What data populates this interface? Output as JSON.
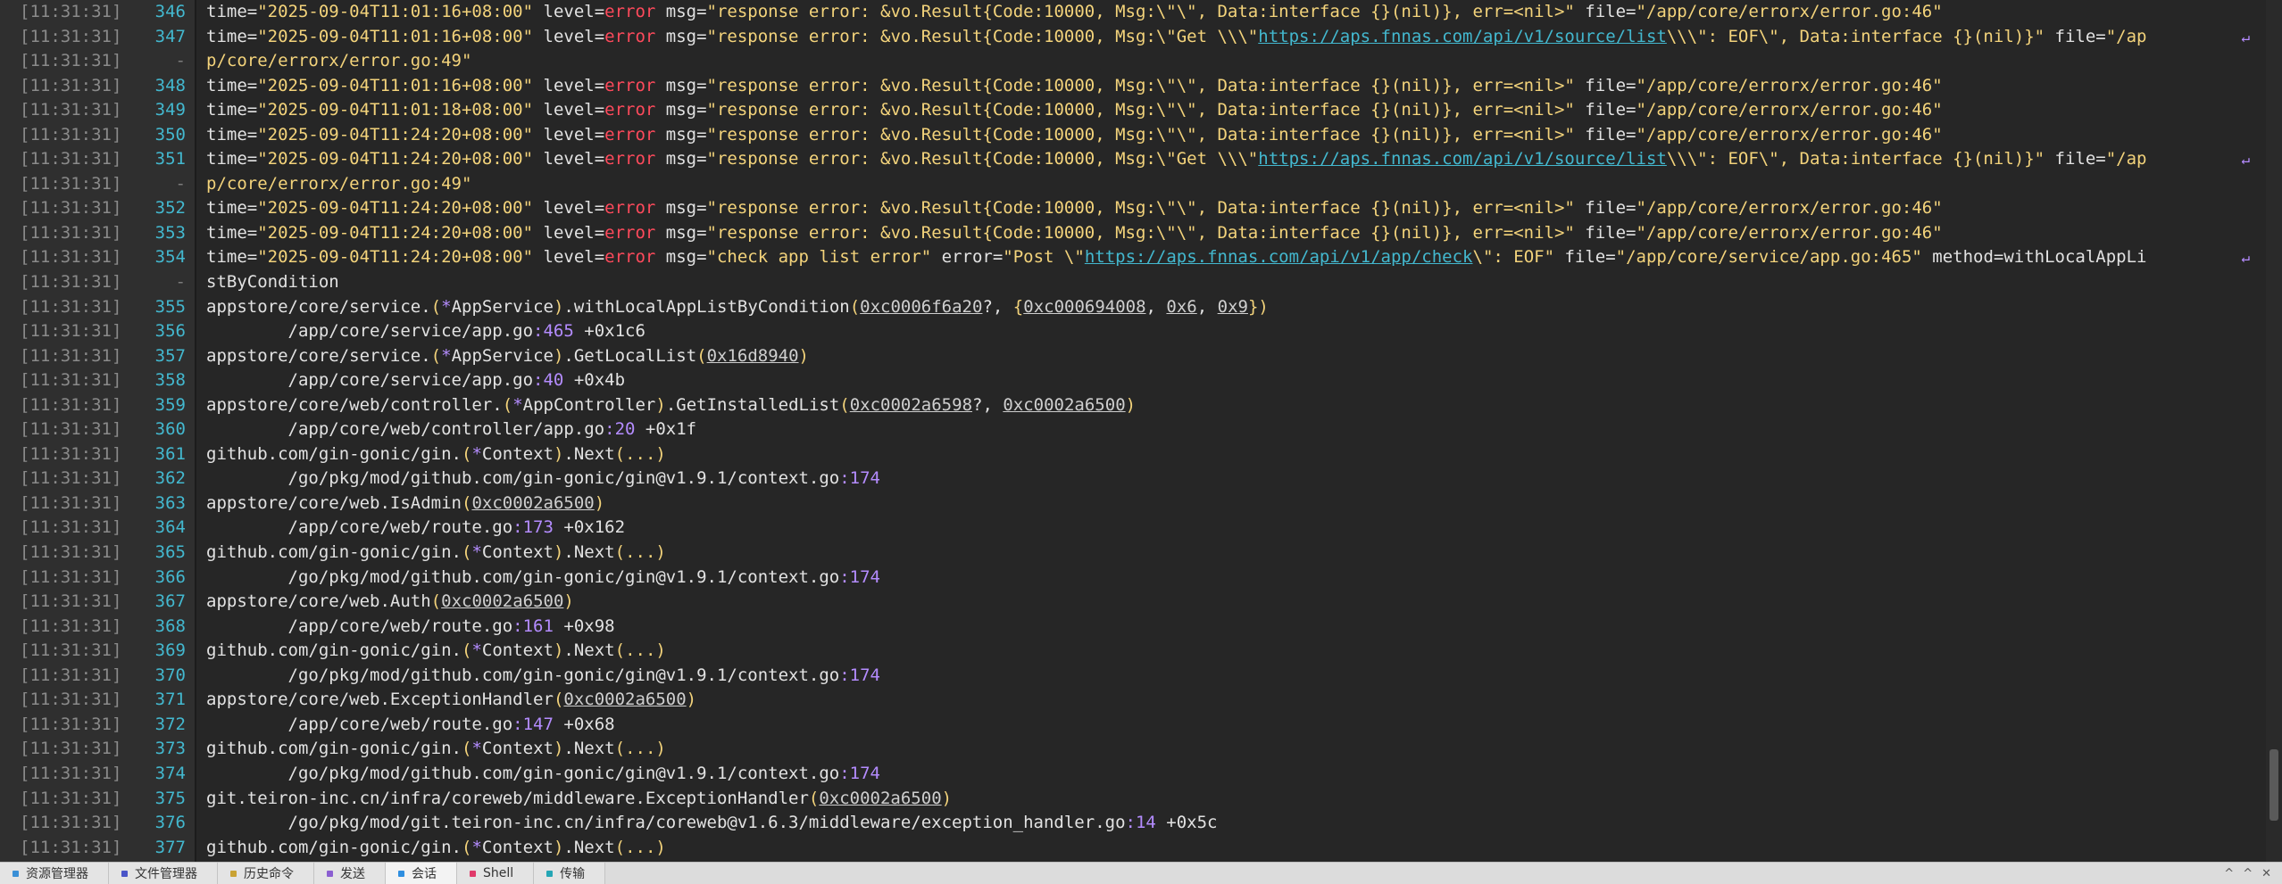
{
  "terminal": {
    "lines": [
      {
        "ts": "[11:31:31]",
        "ln": "346",
        "wrap": false,
        "segs": [
          [
            "t",
            "time="
          ],
          [
            "s",
            "\"2025-09-04T11:01:16+08:00\""
          ],
          [
            "t",
            " level="
          ],
          [
            "e",
            "error"
          ],
          [
            "t",
            " msg="
          ],
          [
            "s",
            "\"response error: &vo.Result{Code:10000, Msg:\\\"\\\", Data:interface {}(nil)}, err=<nil>\""
          ],
          [
            "t",
            " file="
          ],
          [
            "s",
            "\"/app/core/errorx/error.go:46\""
          ]
        ]
      },
      {
        "ts": "[11:31:31]",
        "ln": "347",
        "wrap": true,
        "segs": [
          [
            "t",
            "time="
          ],
          [
            "s",
            "\"2025-09-04T11:01:16+08:00\""
          ],
          [
            "t",
            " level="
          ],
          [
            "e",
            "error"
          ],
          [
            "t",
            " msg="
          ],
          [
            "s",
            "\"response error: &vo.Result{Code:10000, Msg:\\\"Get \\\\\\\""
          ],
          [
            "u",
            "https://aps.fnnas.com/api/v1/source/list"
          ],
          [
            "s",
            "\\\\\\\": EOF\\\", Data:interface {}(nil)}\""
          ],
          [
            "t",
            " file="
          ],
          [
            "s",
            "\"/ap"
          ]
        ]
      },
      {
        "ts": "[11:31:31]",
        "ln": "-",
        "wrap": false,
        "segs": [
          [
            "s",
            "p/core/errorx/error.go:49\""
          ]
        ]
      },
      {
        "ts": "[11:31:31]",
        "ln": "348",
        "wrap": false,
        "segs": [
          [
            "t",
            "time="
          ],
          [
            "s",
            "\"2025-09-04T11:01:16+08:00\""
          ],
          [
            "t",
            " level="
          ],
          [
            "e",
            "error"
          ],
          [
            "t",
            " msg="
          ],
          [
            "s",
            "\"response error: &vo.Result{Code:10000, Msg:\\\"\\\", Data:interface {}(nil)}, err=<nil>\""
          ],
          [
            "t",
            " file="
          ],
          [
            "s",
            "\"/app/core/errorx/error.go:46\""
          ]
        ]
      },
      {
        "ts": "[11:31:31]",
        "ln": "349",
        "wrap": false,
        "segs": [
          [
            "t",
            "time="
          ],
          [
            "s",
            "\"2025-09-04T11:01:18+08:00\""
          ],
          [
            "t",
            " level="
          ],
          [
            "e",
            "error"
          ],
          [
            "t",
            " msg="
          ],
          [
            "s",
            "\"response error: &vo.Result{Code:10000, Msg:\\\"\\\", Data:interface {}(nil)}, err=<nil>\""
          ],
          [
            "t",
            " file="
          ],
          [
            "s",
            "\"/app/core/errorx/error.go:46\""
          ]
        ]
      },
      {
        "ts": "[11:31:31]",
        "ln": "350",
        "wrap": false,
        "segs": [
          [
            "t",
            "time="
          ],
          [
            "s",
            "\"2025-09-04T11:24:20+08:00\""
          ],
          [
            "t",
            " level="
          ],
          [
            "e",
            "error"
          ],
          [
            "t",
            " msg="
          ],
          [
            "s",
            "\"response error: &vo.Result{Code:10000, Msg:\\\"\\\", Data:interface {}(nil)}, err=<nil>\""
          ],
          [
            "t",
            " file="
          ],
          [
            "s",
            "\"/app/core/errorx/error.go:46\""
          ]
        ]
      },
      {
        "ts": "[11:31:31]",
        "ln": "351",
        "wrap": true,
        "segs": [
          [
            "t",
            "time="
          ],
          [
            "s",
            "\"2025-09-04T11:24:20+08:00\""
          ],
          [
            "t",
            " level="
          ],
          [
            "e",
            "error"
          ],
          [
            "t",
            " msg="
          ],
          [
            "s",
            "\"response error: &vo.Result{Code:10000, Msg:\\\"Get \\\\\\\""
          ],
          [
            "u",
            "https://aps.fnnas.com/api/v1/source/list"
          ],
          [
            "s",
            "\\\\\\\": EOF\\\", Data:interface {}(nil)}\""
          ],
          [
            "t",
            " file="
          ],
          [
            "s",
            "\"/ap"
          ]
        ]
      },
      {
        "ts": "[11:31:31]",
        "ln": "-",
        "wrap": false,
        "segs": [
          [
            "s",
            "p/core/errorx/error.go:49\""
          ]
        ]
      },
      {
        "ts": "[11:31:31]",
        "ln": "352",
        "wrap": false,
        "segs": [
          [
            "t",
            "time="
          ],
          [
            "s",
            "\"2025-09-04T11:24:20+08:00\""
          ],
          [
            "t",
            " level="
          ],
          [
            "e",
            "error"
          ],
          [
            "t",
            " msg="
          ],
          [
            "s",
            "\"response error: &vo.Result{Code:10000, Msg:\\\"\\\", Data:interface {}(nil)}, err=<nil>\""
          ],
          [
            "t",
            " file="
          ],
          [
            "s",
            "\"/app/core/errorx/error.go:46\""
          ]
        ]
      },
      {
        "ts": "[11:31:31]",
        "ln": "353",
        "wrap": false,
        "segs": [
          [
            "t",
            "time="
          ],
          [
            "s",
            "\"2025-09-04T11:24:20+08:00\""
          ],
          [
            "t",
            " level="
          ],
          [
            "e",
            "error"
          ],
          [
            "t",
            " msg="
          ],
          [
            "s",
            "\"response error: &vo.Result{Code:10000, Msg:\\\"\\\", Data:interface {}(nil)}, err=<nil>\""
          ],
          [
            "t",
            " file="
          ],
          [
            "s",
            "\"/app/core/errorx/error.go:46\""
          ]
        ]
      },
      {
        "ts": "[11:31:31]",
        "ln": "354",
        "wrap": true,
        "segs": [
          [
            "t",
            "time="
          ],
          [
            "s",
            "\"2025-09-04T11:24:20+08:00\""
          ],
          [
            "t",
            " level="
          ],
          [
            "e",
            "error"
          ],
          [
            "t",
            " msg="
          ],
          [
            "s",
            "\"check app list error\""
          ],
          [
            "t",
            " error="
          ],
          [
            "s",
            "\"Post \\\""
          ],
          [
            "u",
            "https://aps.fnnas.com/api/v1/app/check"
          ],
          [
            "s",
            "\\\": EOF\""
          ],
          [
            "t",
            " file="
          ],
          [
            "s",
            "\"/app/core/service/app.go:465\""
          ],
          [
            "t",
            " method=withLocalAppLi"
          ]
        ]
      },
      {
        "ts": "[11:31:31]",
        "ln": "-",
        "wrap": false,
        "segs": [
          [
            "t",
            "stByCondition"
          ]
        ]
      },
      {
        "ts": "[11:31:31]",
        "ln": "355",
        "wrap": false,
        "segs": [
          [
            "t",
            "appstore/core/service."
          ],
          [
            "p",
            "("
          ],
          [
            "n",
            "*"
          ],
          [
            "t",
            "AppService"
          ],
          [
            "p",
            ")"
          ],
          [
            "t",
            ".withLocalAppListByCondition"
          ],
          [
            "p",
            "("
          ],
          [
            "r",
            "0xc0006f6a20"
          ],
          [
            "t",
            "?"
          ],
          [
            "t",
            ", "
          ],
          [
            "p",
            "{"
          ],
          [
            "r",
            "0xc000694008"
          ],
          [
            "t",
            ", "
          ],
          [
            "r",
            "0x6"
          ],
          [
            "t",
            ", "
          ],
          [
            "r",
            "0x9"
          ],
          [
            "p",
            "})"
          ]
        ]
      },
      {
        "ts": "[11:31:31]",
        "ln": "356",
        "wrap": false,
        "segs": [
          [
            "t",
            "        /app/core/service/app.go"
          ],
          [
            "n",
            ":465"
          ],
          [
            "t",
            " +0x1c6"
          ]
        ]
      },
      {
        "ts": "[11:31:31]",
        "ln": "357",
        "wrap": false,
        "segs": [
          [
            "t",
            "appstore/core/service."
          ],
          [
            "p",
            "("
          ],
          [
            "n",
            "*"
          ],
          [
            "t",
            "AppService"
          ],
          [
            "p",
            ")"
          ],
          [
            "t",
            ".GetLocalList"
          ],
          [
            "p",
            "("
          ],
          [
            "r",
            "0x16d8940"
          ],
          [
            "p",
            ")"
          ]
        ]
      },
      {
        "ts": "[11:31:31]",
        "ln": "358",
        "wrap": false,
        "segs": [
          [
            "t",
            "        /app/core/service/app.go"
          ],
          [
            "n",
            ":40"
          ],
          [
            "t",
            " +0x4b"
          ]
        ]
      },
      {
        "ts": "[11:31:31]",
        "ln": "359",
        "wrap": false,
        "segs": [
          [
            "t",
            "appstore/core/web/controller."
          ],
          [
            "p",
            "("
          ],
          [
            "n",
            "*"
          ],
          [
            "t",
            "AppController"
          ],
          [
            "p",
            ")"
          ],
          [
            "t",
            ".GetInstalledList"
          ],
          [
            "p",
            "("
          ],
          [
            "r",
            "0xc0002a6598"
          ],
          [
            "t",
            "?"
          ],
          [
            "t",
            ", "
          ],
          [
            "r",
            "0xc0002a6500"
          ],
          [
            "p",
            ")"
          ]
        ]
      },
      {
        "ts": "[11:31:31]",
        "ln": "360",
        "wrap": false,
        "segs": [
          [
            "t",
            "        /app/core/web/controller/app.go"
          ],
          [
            "n",
            ":20"
          ],
          [
            "t",
            " +0x1f"
          ]
        ]
      },
      {
        "ts": "[11:31:31]",
        "ln": "361",
        "wrap": false,
        "segs": [
          [
            "t",
            "github.com/gin-gonic/gin."
          ],
          [
            "p",
            "("
          ],
          [
            "n",
            "*"
          ],
          [
            "t",
            "Context"
          ],
          [
            "p",
            ")"
          ],
          [
            "t",
            ".Next"
          ],
          [
            "p",
            "(...)"
          ]
        ]
      },
      {
        "ts": "[11:31:31]",
        "ln": "362",
        "wrap": false,
        "segs": [
          [
            "t",
            "        /go/pkg/mod/github.com/gin-gonic/gin@v1.9.1/context.go"
          ],
          [
            "n",
            ":174"
          ]
        ]
      },
      {
        "ts": "[11:31:31]",
        "ln": "363",
        "wrap": false,
        "segs": [
          [
            "t",
            "appstore/core/web.IsAdmin"
          ],
          [
            "p",
            "("
          ],
          [
            "r",
            "0xc0002a6500"
          ],
          [
            "p",
            ")"
          ]
        ]
      },
      {
        "ts": "[11:31:31]",
        "ln": "364",
        "wrap": false,
        "segs": [
          [
            "t",
            "        /app/core/web/route.go"
          ],
          [
            "n",
            ":173"
          ],
          [
            "t",
            " +0x162"
          ]
        ]
      },
      {
        "ts": "[11:31:31]",
        "ln": "365",
        "wrap": false,
        "segs": [
          [
            "t",
            "github.com/gin-gonic/gin."
          ],
          [
            "p",
            "("
          ],
          [
            "n",
            "*"
          ],
          [
            "t",
            "Context"
          ],
          [
            "p",
            ")"
          ],
          [
            "t",
            ".Next"
          ],
          [
            "p",
            "(...)"
          ]
        ]
      },
      {
        "ts": "[11:31:31]",
        "ln": "366",
        "wrap": false,
        "segs": [
          [
            "t",
            "        /go/pkg/mod/github.com/gin-gonic/gin@v1.9.1/context.go"
          ],
          [
            "n",
            ":174"
          ]
        ]
      },
      {
        "ts": "[11:31:31]",
        "ln": "367",
        "wrap": false,
        "segs": [
          [
            "t",
            "appstore/core/web.Auth"
          ],
          [
            "p",
            "("
          ],
          [
            "r",
            "0xc0002a6500"
          ],
          [
            "p",
            ")"
          ]
        ]
      },
      {
        "ts": "[11:31:31]",
        "ln": "368",
        "wrap": false,
        "segs": [
          [
            "t",
            "        /app/core/web/route.go"
          ],
          [
            "n",
            ":161"
          ],
          [
            "t",
            " +0x98"
          ]
        ]
      },
      {
        "ts": "[11:31:31]",
        "ln": "369",
        "wrap": false,
        "segs": [
          [
            "t",
            "github.com/gin-gonic/gin."
          ],
          [
            "p",
            "("
          ],
          [
            "n",
            "*"
          ],
          [
            "t",
            "Context"
          ],
          [
            "p",
            ")"
          ],
          [
            "t",
            ".Next"
          ],
          [
            "p",
            "(...)"
          ]
        ]
      },
      {
        "ts": "[11:31:31]",
        "ln": "370",
        "wrap": false,
        "segs": [
          [
            "t",
            "        /go/pkg/mod/github.com/gin-gonic/gin@v1.9.1/context.go"
          ],
          [
            "n",
            ":174"
          ]
        ]
      },
      {
        "ts": "[11:31:31]",
        "ln": "371",
        "wrap": false,
        "segs": [
          [
            "t",
            "appstore/core/web.ExceptionHandler"
          ],
          [
            "p",
            "("
          ],
          [
            "r",
            "0xc0002a6500"
          ],
          [
            "p",
            ")"
          ]
        ]
      },
      {
        "ts": "[11:31:31]",
        "ln": "372",
        "wrap": false,
        "segs": [
          [
            "t",
            "        /app/core/web/route.go"
          ],
          [
            "n",
            ":147"
          ],
          [
            "t",
            " +0x68"
          ]
        ]
      },
      {
        "ts": "[11:31:31]",
        "ln": "373",
        "wrap": false,
        "segs": [
          [
            "t",
            "github.com/gin-gonic/gin."
          ],
          [
            "p",
            "("
          ],
          [
            "n",
            "*"
          ],
          [
            "t",
            "Context"
          ],
          [
            "p",
            ")"
          ],
          [
            "t",
            ".Next"
          ],
          [
            "p",
            "(...)"
          ]
        ]
      },
      {
        "ts": "[11:31:31]",
        "ln": "374",
        "wrap": false,
        "segs": [
          [
            "t",
            "        /go/pkg/mod/github.com/gin-gonic/gin@v1.9.1/context.go"
          ],
          [
            "n",
            ":174"
          ]
        ]
      },
      {
        "ts": "[11:31:31]",
        "ln": "375",
        "wrap": false,
        "segs": [
          [
            "t",
            "git.teiron-inc.cn/infra/coreweb/middleware.ExceptionHandler"
          ],
          [
            "p",
            "("
          ],
          [
            "r",
            "0xc0002a6500"
          ],
          [
            "p",
            ")"
          ]
        ]
      },
      {
        "ts": "[11:31:31]",
        "ln": "376",
        "wrap": false,
        "segs": [
          [
            "t",
            "        /go/pkg/mod/git.teiron-inc.cn/infra/coreweb@v1.6.3/middleware/exception_handler.go"
          ],
          [
            "n",
            ":14"
          ],
          [
            "t",
            " +0x5c"
          ]
        ]
      },
      {
        "ts": "[11:31:31]",
        "ln": "377",
        "wrap": false,
        "segs": [
          [
            "t",
            "github.com/gin-gonic/gin."
          ],
          [
            "p",
            "("
          ],
          [
            "n",
            "*"
          ],
          [
            "t",
            "Context"
          ],
          [
            "p",
            ")"
          ],
          [
            "t",
            ".Next"
          ],
          [
            "p",
            "(...)"
          ]
        ]
      }
    ]
  },
  "tabbar": {
    "tabs": [
      {
        "label": "资源管理器",
        "color": "#3a8fd6",
        "active": false
      },
      {
        "label": "文件管理器",
        "color": "#4a55c8",
        "active": false
      },
      {
        "label": "历史命令",
        "color": "#c9a233",
        "active": false
      },
      {
        "label": "发送",
        "color": "#8b5fd1",
        "active": false
      },
      {
        "label": "会话",
        "color": "#2f8fe0",
        "active": true
      },
      {
        "label": "Shell",
        "color": "#e03a6a",
        "active": false
      },
      {
        "label": "传输",
        "color": "#25a6b5",
        "active": false
      }
    ],
    "controls": [
      "^",
      "^",
      "✕"
    ]
  },
  "colors": {
    "string": "#f3d37b",
    "error": "#ff4a5c",
    "url": "#43b8cf",
    "number": "#b48cff",
    "line_number": "#43b8cf"
  }
}
